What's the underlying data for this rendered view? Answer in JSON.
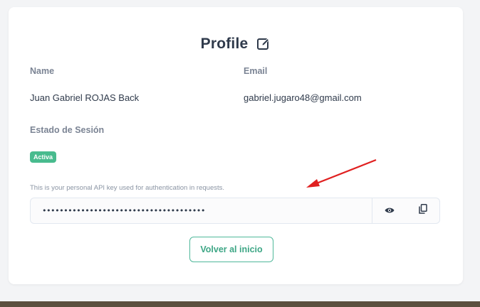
{
  "profile": {
    "title": "Profile",
    "name_label": "Name",
    "name_value": "Juan Gabriel ROJAS Back",
    "email_label": "Email",
    "email_value": "gabriel.jugaro48@gmail.com",
    "session_label": "Estado de Sesión",
    "session_status": "Activa",
    "api_hint": "This is your personal API key used for authentication in requests.",
    "api_key_masked": "••••••••••••••••••••••••••••••••••••••",
    "home_button": "Volver al inicio"
  },
  "icons": {
    "edit": "edit-icon",
    "show": "eye-icon",
    "copy": "copy-icon"
  },
  "colors": {
    "accent": "#48bb8e",
    "button_text": "#3da685",
    "annotation_arrow": "#e02020"
  }
}
